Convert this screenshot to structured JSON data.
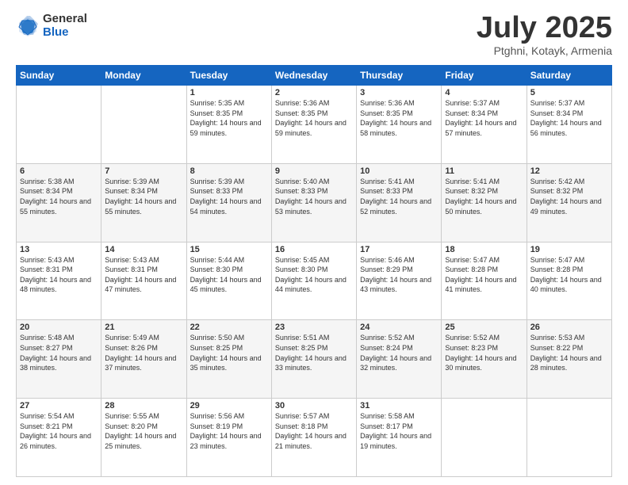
{
  "header": {
    "logo_general": "General",
    "logo_blue": "Blue",
    "title": "July 2025",
    "location": "Ptghni, Kotayk, Armenia"
  },
  "weekdays": [
    "Sunday",
    "Monday",
    "Tuesday",
    "Wednesday",
    "Thursday",
    "Friday",
    "Saturday"
  ],
  "weeks": [
    [
      {
        "day": "",
        "sunrise": "",
        "sunset": "",
        "daylight": ""
      },
      {
        "day": "",
        "sunrise": "",
        "sunset": "",
        "daylight": ""
      },
      {
        "day": "1",
        "sunrise": "Sunrise: 5:35 AM",
        "sunset": "Sunset: 8:35 PM",
        "daylight": "Daylight: 14 hours and 59 minutes."
      },
      {
        "day": "2",
        "sunrise": "Sunrise: 5:36 AM",
        "sunset": "Sunset: 8:35 PM",
        "daylight": "Daylight: 14 hours and 59 minutes."
      },
      {
        "day": "3",
        "sunrise": "Sunrise: 5:36 AM",
        "sunset": "Sunset: 8:35 PM",
        "daylight": "Daylight: 14 hours and 58 minutes."
      },
      {
        "day": "4",
        "sunrise": "Sunrise: 5:37 AM",
        "sunset": "Sunset: 8:34 PM",
        "daylight": "Daylight: 14 hours and 57 minutes."
      },
      {
        "day": "5",
        "sunrise": "Sunrise: 5:37 AM",
        "sunset": "Sunset: 8:34 PM",
        "daylight": "Daylight: 14 hours and 56 minutes."
      }
    ],
    [
      {
        "day": "6",
        "sunrise": "Sunrise: 5:38 AM",
        "sunset": "Sunset: 8:34 PM",
        "daylight": "Daylight: 14 hours and 55 minutes."
      },
      {
        "day": "7",
        "sunrise": "Sunrise: 5:39 AM",
        "sunset": "Sunset: 8:34 PM",
        "daylight": "Daylight: 14 hours and 55 minutes."
      },
      {
        "day": "8",
        "sunrise": "Sunrise: 5:39 AM",
        "sunset": "Sunset: 8:33 PM",
        "daylight": "Daylight: 14 hours and 54 minutes."
      },
      {
        "day": "9",
        "sunrise": "Sunrise: 5:40 AM",
        "sunset": "Sunset: 8:33 PM",
        "daylight": "Daylight: 14 hours and 53 minutes."
      },
      {
        "day": "10",
        "sunrise": "Sunrise: 5:41 AM",
        "sunset": "Sunset: 8:33 PM",
        "daylight": "Daylight: 14 hours and 52 minutes."
      },
      {
        "day": "11",
        "sunrise": "Sunrise: 5:41 AM",
        "sunset": "Sunset: 8:32 PM",
        "daylight": "Daylight: 14 hours and 50 minutes."
      },
      {
        "day": "12",
        "sunrise": "Sunrise: 5:42 AM",
        "sunset": "Sunset: 8:32 PM",
        "daylight": "Daylight: 14 hours and 49 minutes."
      }
    ],
    [
      {
        "day": "13",
        "sunrise": "Sunrise: 5:43 AM",
        "sunset": "Sunset: 8:31 PM",
        "daylight": "Daylight: 14 hours and 48 minutes."
      },
      {
        "day": "14",
        "sunrise": "Sunrise: 5:43 AM",
        "sunset": "Sunset: 8:31 PM",
        "daylight": "Daylight: 14 hours and 47 minutes."
      },
      {
        "day": "15",
        "sunrise": "Sunrise: 5:44 AM",
        "sunset": "Sunset: 8:30 PM",
        "daylight": "Daylight: 14 hours and 45 minutes."
      },
      {
        "day": "16",
        "sunrise": "Sunrise: 5:45 AM",
        "sunset": "Sunset: 8:30 PM",
        "daylight": "Daylight: 14 hours and 44 minutes."
      },
      {
        "day": "17",
        "sunrise": "Sunrise: 5:46 AM",
        "sunset": "Sunset: 8:29 PM",
        "daylight": "Daylight: 14 hours and 43 minutes."
      },
      {
        "day": "18",
        "sunrise": "Sunrise: 5:47 AM",
        "sunset": "Sunset: 8:28 PM",
        "daylight": "Daylight: 14 hours and 41 minutes."
      },
      {
        "day": "19",
        "sunrise": "Sunrise: 5:47 AM",
        "sunset": "Sunset: 8:28 PM",
        "daylight": "Daylight: 14 hours and 40 minutes."
      }
    ],
    [
      {
        "day": "20",
        "sunrise": "Sunrise: 5:48 AM",
        "sunset": "Sunset: 8:27 PM",
        "daylight": "Daylight: 14 hours and 38 minutes."
      },
      {
        "day": "21",
        "sunrise": "Sunrise: 5:49 AM",
        "sunset": "Sunset: 8:26 PM",
        "daylight": "Daylight: 14 hours and 37 minutes."
      },
      {
        "day": "22",
        "sunrise": "Sunrise: 5:50 AM",
        "sunset": "Sunset: 8:25 PM",
        "daylight": "Daylight: 14 hours and 35 minutes."
      },
      {
        "day": "23",
        "sunrise": "Sunrise: 5:51 AM",
        "sunset": "Sunset: 8:25 PM",
        "daylight": "Daylight: 14 hours and 33 minutes."
      },
      {
        "day": "24",
        "sunrise": "Sunrise: 5:52 AM",
        "sunset": "Sunset: 8:24 PM",
        "daylight": "Daylight: 14 hours and 32 minutes."
      },
      {
        "day": "25",
        "sunrise": "Sunrise: 5:52 AM",
        "sunset": "Sunset: 8:23 PM",
        "daylight": "Daylight: 14 hours and 30 minutes."
      },
      {
        "day": "26",
        "sunrise": "Sunrise: 5:53 AM",
        "sunset": "Sunset: 8:22 PM",
        "daylight": "Daylight: 14 hours and 28 minutes."
      }
    ],
    [
      {
        "day": "27",
        "sunrise": "Sunrise: 5:54 AM",
        "sunset": "Sunset: 8:21 PM",
        "daylight": "Daylight: 14 hours and 26 minutes."
      },
      {
        "day": "28",
        "sunrise": "Sunrise: 5:55 AM",
        "sunset": "Sunset: 8:20 PM",
        "daylight": "Daylight: 14 hours and 25 minutes."
      },
      {
        "day": "29",
        "sunrise": "Sunrise: 5:56 AM",
        "sunset": "Sunset: 8:19 PM",
        "daylight": "Daylight: 14 hours and 23 minutes."
      },
      {
        "day": "30",
        "sunrise": "Sunrise: 5:57 AM",
        "sunset": "Sunset: 8:18 PM",
        "daylight": "Daylight: 14 hours and 21 minutes."
      },
      {
        "day": "31",
        "sunrise": "Sunrise: 5:58 AM",
        "sunset": "Sunset: 8:17 PM",
        "daylight": "Daylight: 14 hours and 19 minutes."
      },
      {
        "day": "",
        "sunrise": "",
        "sunset": "",
        "daylight": ""
      },
      {
        "day": "",
        "sunrise": "",
        "sunset": "",
        "daylight": ""
      }
    ]
  ]
}
